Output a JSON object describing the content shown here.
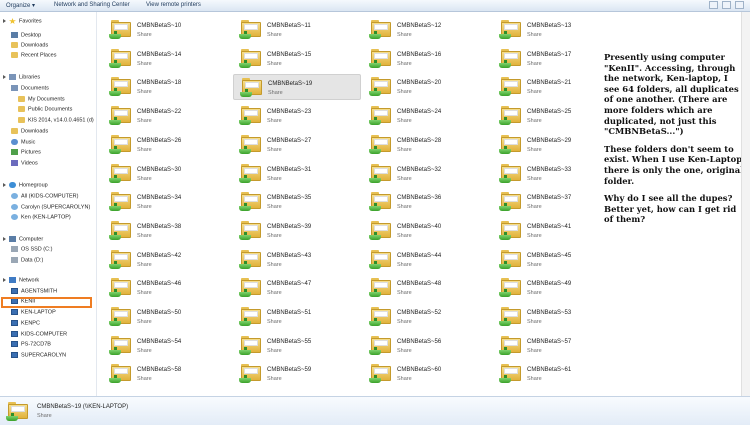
{
  "toolbar": {
    "organize": "Organize ▾",
    "network_sharing": "Network and Sharing Center",
    "view_printers": "View remote printers"
  },
  "nav": [
    {
      "label": "Favorites",
      "icon": "star-icon",
      "kind": "header"
    },
    {
      "label": "Desktop",
      "icon": "desktop-icon",
      "kind": "item"
    },
    {
      "label": "Downloads",
      "icon": "downloads-icon",
      "kind": "item"
    },
    {
      "label": "Recent Places",
      "icon": "recent-places-icon",
      "kind": "item"
    },
    {
      "label": "Libraries",
      "icon": "libraries-icon",
      "kind": "header"
    },
    {
      "label": "Documents",
      "icon": "documents-icon",
      "kind": "item"
    },
    {
      "label": "My Documents",
      "icon": "folder-icon",
      "kind": "sub"
    },
    {
      "label": "Public Documents",
      "icon": "folder-icon",
      "kind": "sub"
    },
    {
      "label": "KIS 2014, v14.0.0.4651 (d)",
      "icon": "folder-icon",
      "kind": "sub"
    },
    {
      "label": "Downloads",
      "icon": "folder-icon",
      "kind": "item"
    },
    {
      "label": "Music",
      "icon": "music-icon",
      "kind": "item"
    },
    {
      "label": "Pictures",
      "icon": "pictures-icon",
      "kind": "item"
    },
    {
      "label": "Videos",
      "icon": "videos-icon",
      "kind": "item"
    },
    {
      "label": "Homegroup",
      "icon": "homegroup-icon",
      "kind": "header"
    },
    {
      "label": "All (KIDS-COMPUTER)",
      "icon": "user-icon",
      "kind": "item"
    },
    {
      "label": "Carolyn (SUPERCAROLYN)",
      "icon": "user-icon",
      "kind": "item"
    },
    {
      "label": "Ken (KEN-LAPTOP)",
      "icon": "user-icon",
      "kind": "item"
    },
    {
      "label": "Computer",
      "icon": "computer-icon",
      "kind": "header"
    },
    {
      "label": "OS SSD (C:)",
      "icon": "drive-icon",
      "kind": "item"
    },
    {
      "label": "Data (D:)",
      "icon": "drive-icon",
      "kind": "item"
    },
    {
      "label": "Network",
      "icon": "network-icon",
      "kind": "header"
    },
    {
      "label": "AGENTSMITH",
      "icon": "network-computer-icon",
      "kind": "item"
    },
    {
      "label": "KENII",
      "icon": "network-computer-icon",
      "kind": "item"
    },
    {
      "label": "KEN-LAPTOP",
      "icon": "network-computer-icon",
      "kind": "item"
    },
    {
      "label": "KENPC",
      "icon": "network-computer-icon",
      "kind": "item"
    },
    {
      "label": "KIDS-COMPUTER",
      "icon": "network-computer-icon",
      "kind": "item"
    },
    {
      "label": "PS-72CD7B",
      "icon": "network-computer-icon",
      "kind": "item"
    },
    {
      "label": "SUPERCAROLYN",
      "icon": "network-computer-icon",
      "kind": "item"
    }
  ],
  "highlight_color": "#ef7d22",
  "folders": [
    {
      "name": "CMBNBetaS~10",
      "sub": "Share"
    },
    {
      "name": "CMBNBetaS~11",
      "sub": "Share"
    },
    {
      "name": "CMBNBetaS~12",
      "sub": "Share"
    },
    {
      "name": "CMBNBetaS~13",
      "sub": "Share"
    },
    {
      "name": "CMBNBetaS~14",
      "sub": "Share"
    },
    {
      "name": "CMBNBetaS~15",
      "sub": "Share"
    },
    {
      "name": "CMBNBetaS~16",
      "sub": "Share"
    },
    {
      "name": "CMBNBetaS~17",
      "sub": "Share"
    },
    {
      "name": "CMBNBetaS~18",
      "sub": "Share"
    },
    {
      "name": "CMBNBetaS~19",
      "sub": "Share",
      "selected": true
    },
    {
      "name": "CMBNBetaS~20",
      "sub": "Share"
    },
    {
      "name": "CMBNBetaS~21",
      "sub": "Share"
    },
    {
      "name": "CMBNBetaS~22",
      "sub": "Share"
    },
    {
      "name": "CMBNBetaS~23",
      "sub": "Share"
    },
    {
      "name": "CMBNBetaS~24",
      "sub": "Share"
    },
    {
      "name": "CMBNBetaS~25",
      "sub": "Share"
    },
    {
      "name": "CMBNBetaS~26",
      "sub": "Share"
    },
    {
      "name": "CMBNBetaS~27",
      "sub": "Share"
    },
    {
      "name": "CMBNBetaS~28",
      "sub": "Share"
    },
    {
      "name": "CMBNBetaS~29",
      "sub": "Share"
    },
    {
      "name": "CMBNBetaS~30",
      "sub": "Share"
    },
    {
      "name": "CMBNBetaS~31",
      "sub": "Share"
    },
    {
      "name": "CMBNBetaS~32",
      "sub": "Share"
    },
    {
      "name": "CMBNBetaS~33",
      "sub": "Share"
    },
    {
      "name": "CMBNBetaS~34",
      "sub": "Share"
    },
    {
      "name": "CMBNBetaS~35",
      "sub": "Share"
    },
    {
      "name": "CMBNBetaS~36",
      "sub": "Share"
    },
    {
      "name": "CMBNBetaS~37",
      "sub": "Share"
    },
    {
      "name": "CMBNBetaS~38",
      "sub": "Share"
    },
    {
      "name": "CMBNBetaS~39",
      "sub": "Share"
    },
    {
      "name": "CMBNBetaS~40",
      "sub": "Share"
    },
    {
      "name": "CMBNBetaS~41",
      "sub": "Share"
    },
    {
      "name": "CMBNBetaS~42",
      "sub": "Share"
    },
    {
      "name": "CMBNBetaS~43",
      "sub": "Share"
    },
    {
      "name": "CMBNBetaS~44",
      "sub": "Share"
    },
    {
      "name": "CMBNBetaS~45",
      "sub": "Share"
    },
    {
      "name": "CMBNBetaS~46",
      "sub": "Share"
    },
    {
      "name": "CMBNBetaS~47",
      "sub": "Share"
    },
    {
      "name": "CMBNBetaS~48",
      "sub": "Share"
    },
    {
      "name": "CMBNBetaS~49",
      "sub": "Share"
    },
    {
      "name": "CMBNBetaS~50",
      "sub": "Share"
    },
    {
      "name": "CMBNBetaS~51",
      "sub": "Share"
    },
    {
      "name": "CMBNBetaS~52",
      "sub": "Share"
    },
    {
      "name": "CMBNBetaS~53",
      "sub": "Share"
    },
    {
      "name": "CMBNBetaS~54",
      "sub": "Share"
    },
    {
      "name": "CMBNBetaS~55",
      "sub": "Share"
    },
    {
      "name": "CMBNBetaS~56",
      "sub": "Share"
    },
    {
      "name": "CMBNBetaS~57",
      "sub": "Share"
    },
    {
      "name": "CMBNBetaS~58",
      "sub": "Share"
    },
    {
      "name": "CMBNBetaS~59",
      "sub": "Share"
    },
    {
      "name": "CMBNBetaS~60",
      "sub": "Share"
    },
    {
      "name": "CMBNBetaS~61",
      "sub": "Share"
    }
  ],
  "note": {
    "p1": "Presently using computer \"KenII\". Accessing, through the network, Ken-laptop, I see 64 folders, all duplicates of one another. (There are more folders which are duplicated, not just this \"CMBNBetaS...\")",
    "p2": "These folders don't seem to exist. When I use Ken-Laptop, there is only the one, original folder.",
    "p3": "Why do I see all the dupes? Better yet, how can I get rid of them?"
  },
  "details": {
    "name": "CMBNBetaS~19 (\\\\KEN-LAPTOP)",
    "sub": "Share"
  }
}
